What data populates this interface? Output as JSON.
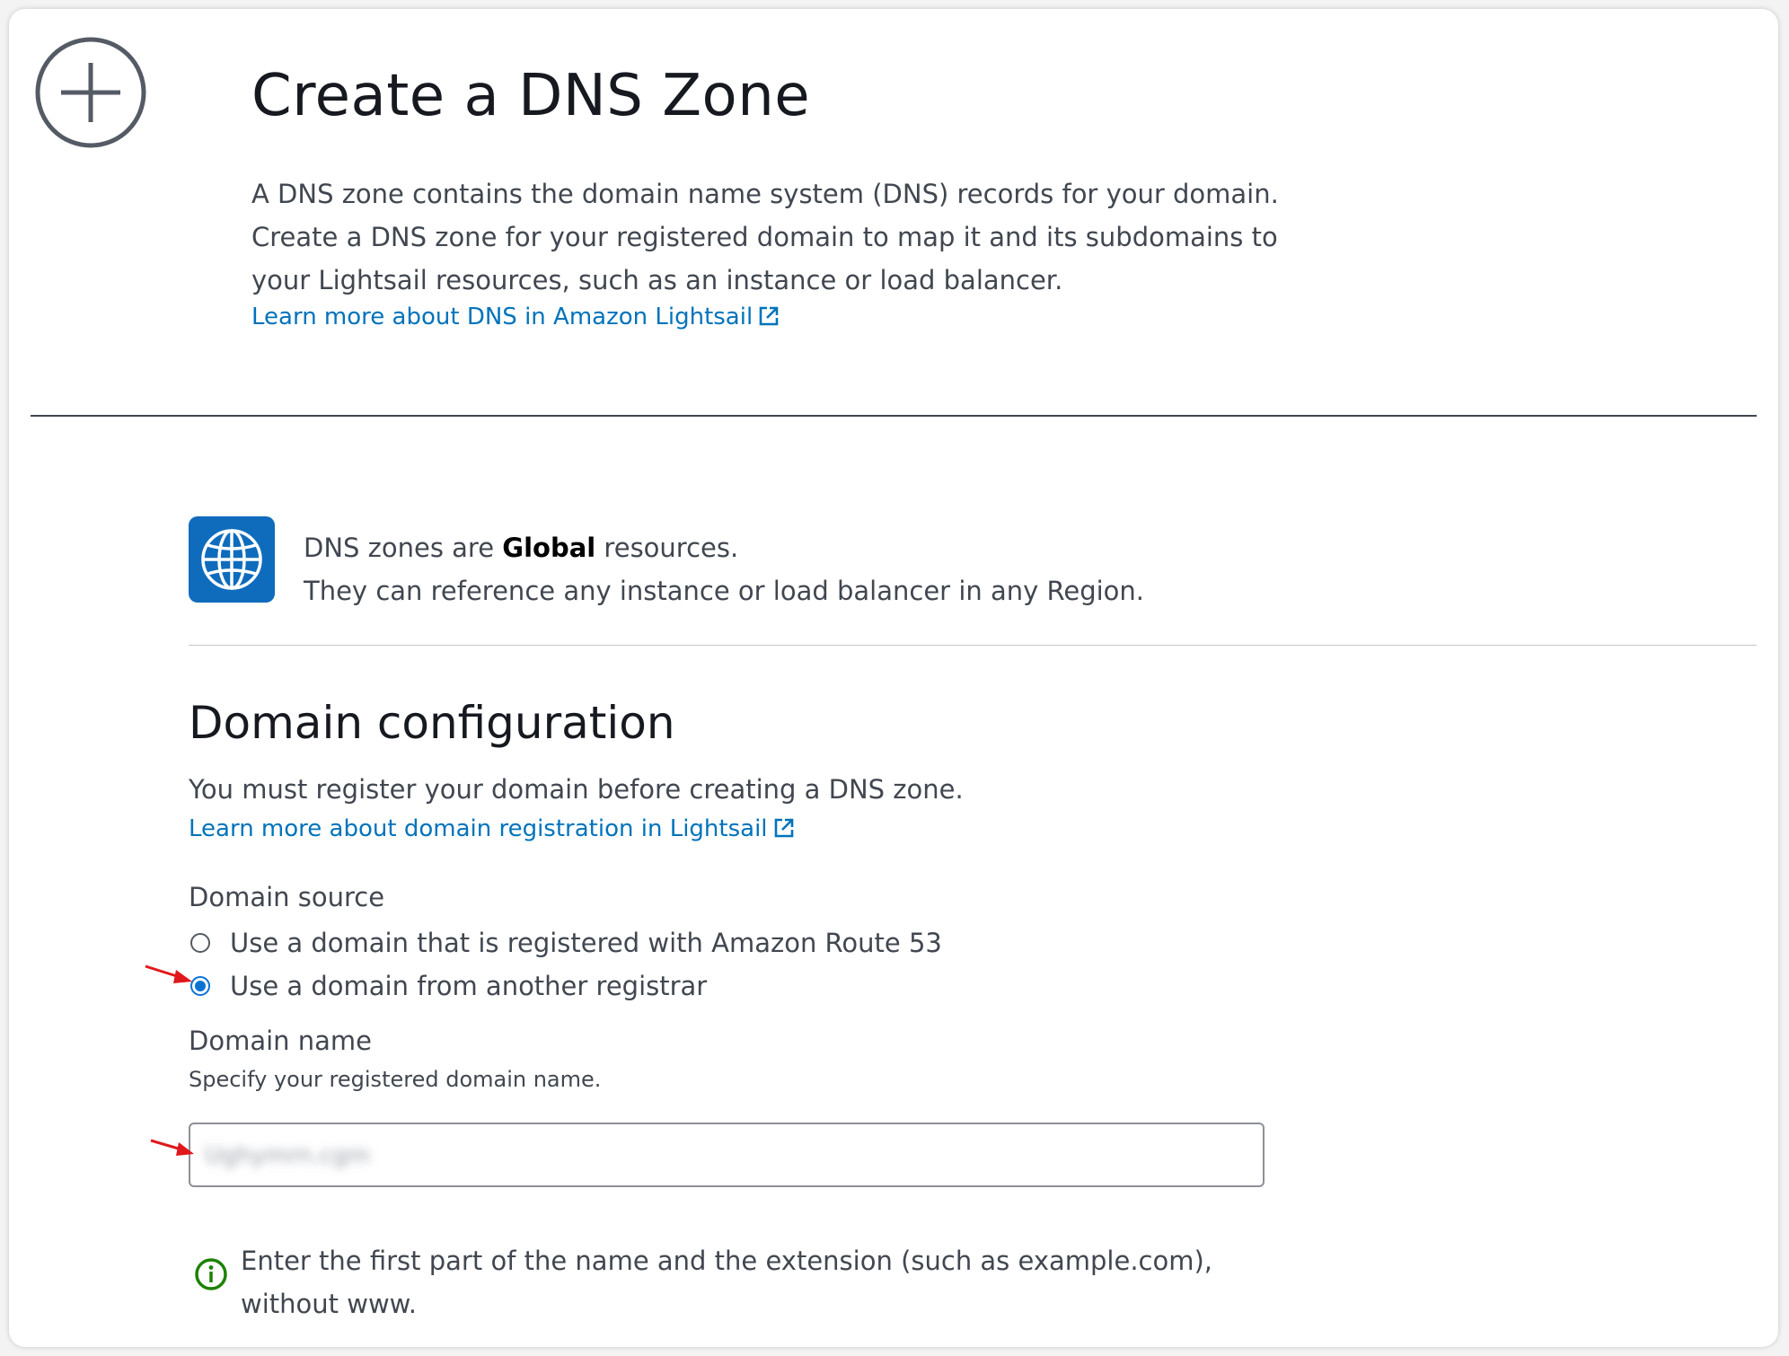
{
  "header": {
    "title": "Create a DNS Zone",
    "intro_lines": [
      "A DNS zone contains the domain name system (DNS) records for your domain.",
      "Create a DNS zone for your registered domain to map it and its subdomains to",
      "your Lightsail resources, such as an instance or load balancer."
    ],
    "learn_more_link": "Learn more about DNS in Amazon Lightsail"
  },
  "global_notice": {
    "line1_prefix": "DNS zones are ",
    "line1_bold": "Global",
    "line1_suffix": " resources.",
    "line2": "They can reference any instance or load balancer in any Region."
  },
  "domain_config": {
    "title": "Domain configuration",
    "must_register": "You must register your domain before creating a DNS zone.",
    "learn_more_link": "Learn more about domain registration in Lightsail",
    "source_label": "Domain source",
    "options": [
      {
        "label": "Use a domain that is registered with Amazon Route 53",
        "selected": false
      },
      {
        "label": "Use a domain from another registrar",
        "selected": true
      }
    ],
    "name_label": "Domain name",
    "name_hint": "Specify your registered domain name.",
    "name_value_blurred": "Ughymrn.cgm",
    "info_lines": [
      "Enter the first part of the name and the extension (such as example.com),",
      "without www."
    ]
  },
  "colors": {
    "link": "#0073bb",
    "radio_selected": "#0972d3",
    "globe_tile": "#0f6cbd",
    "info_icon": "#1d8102",
    "annotation_arrow": "#e0181b"
  },
  "icons": {
    "add": "plus-circle-icon",
    "external": "external-link-icon",
    "globe": "globe-icon",
    "info": "info-circle-icon",
    "annotation": "red-arrow-icon"
  }
}
